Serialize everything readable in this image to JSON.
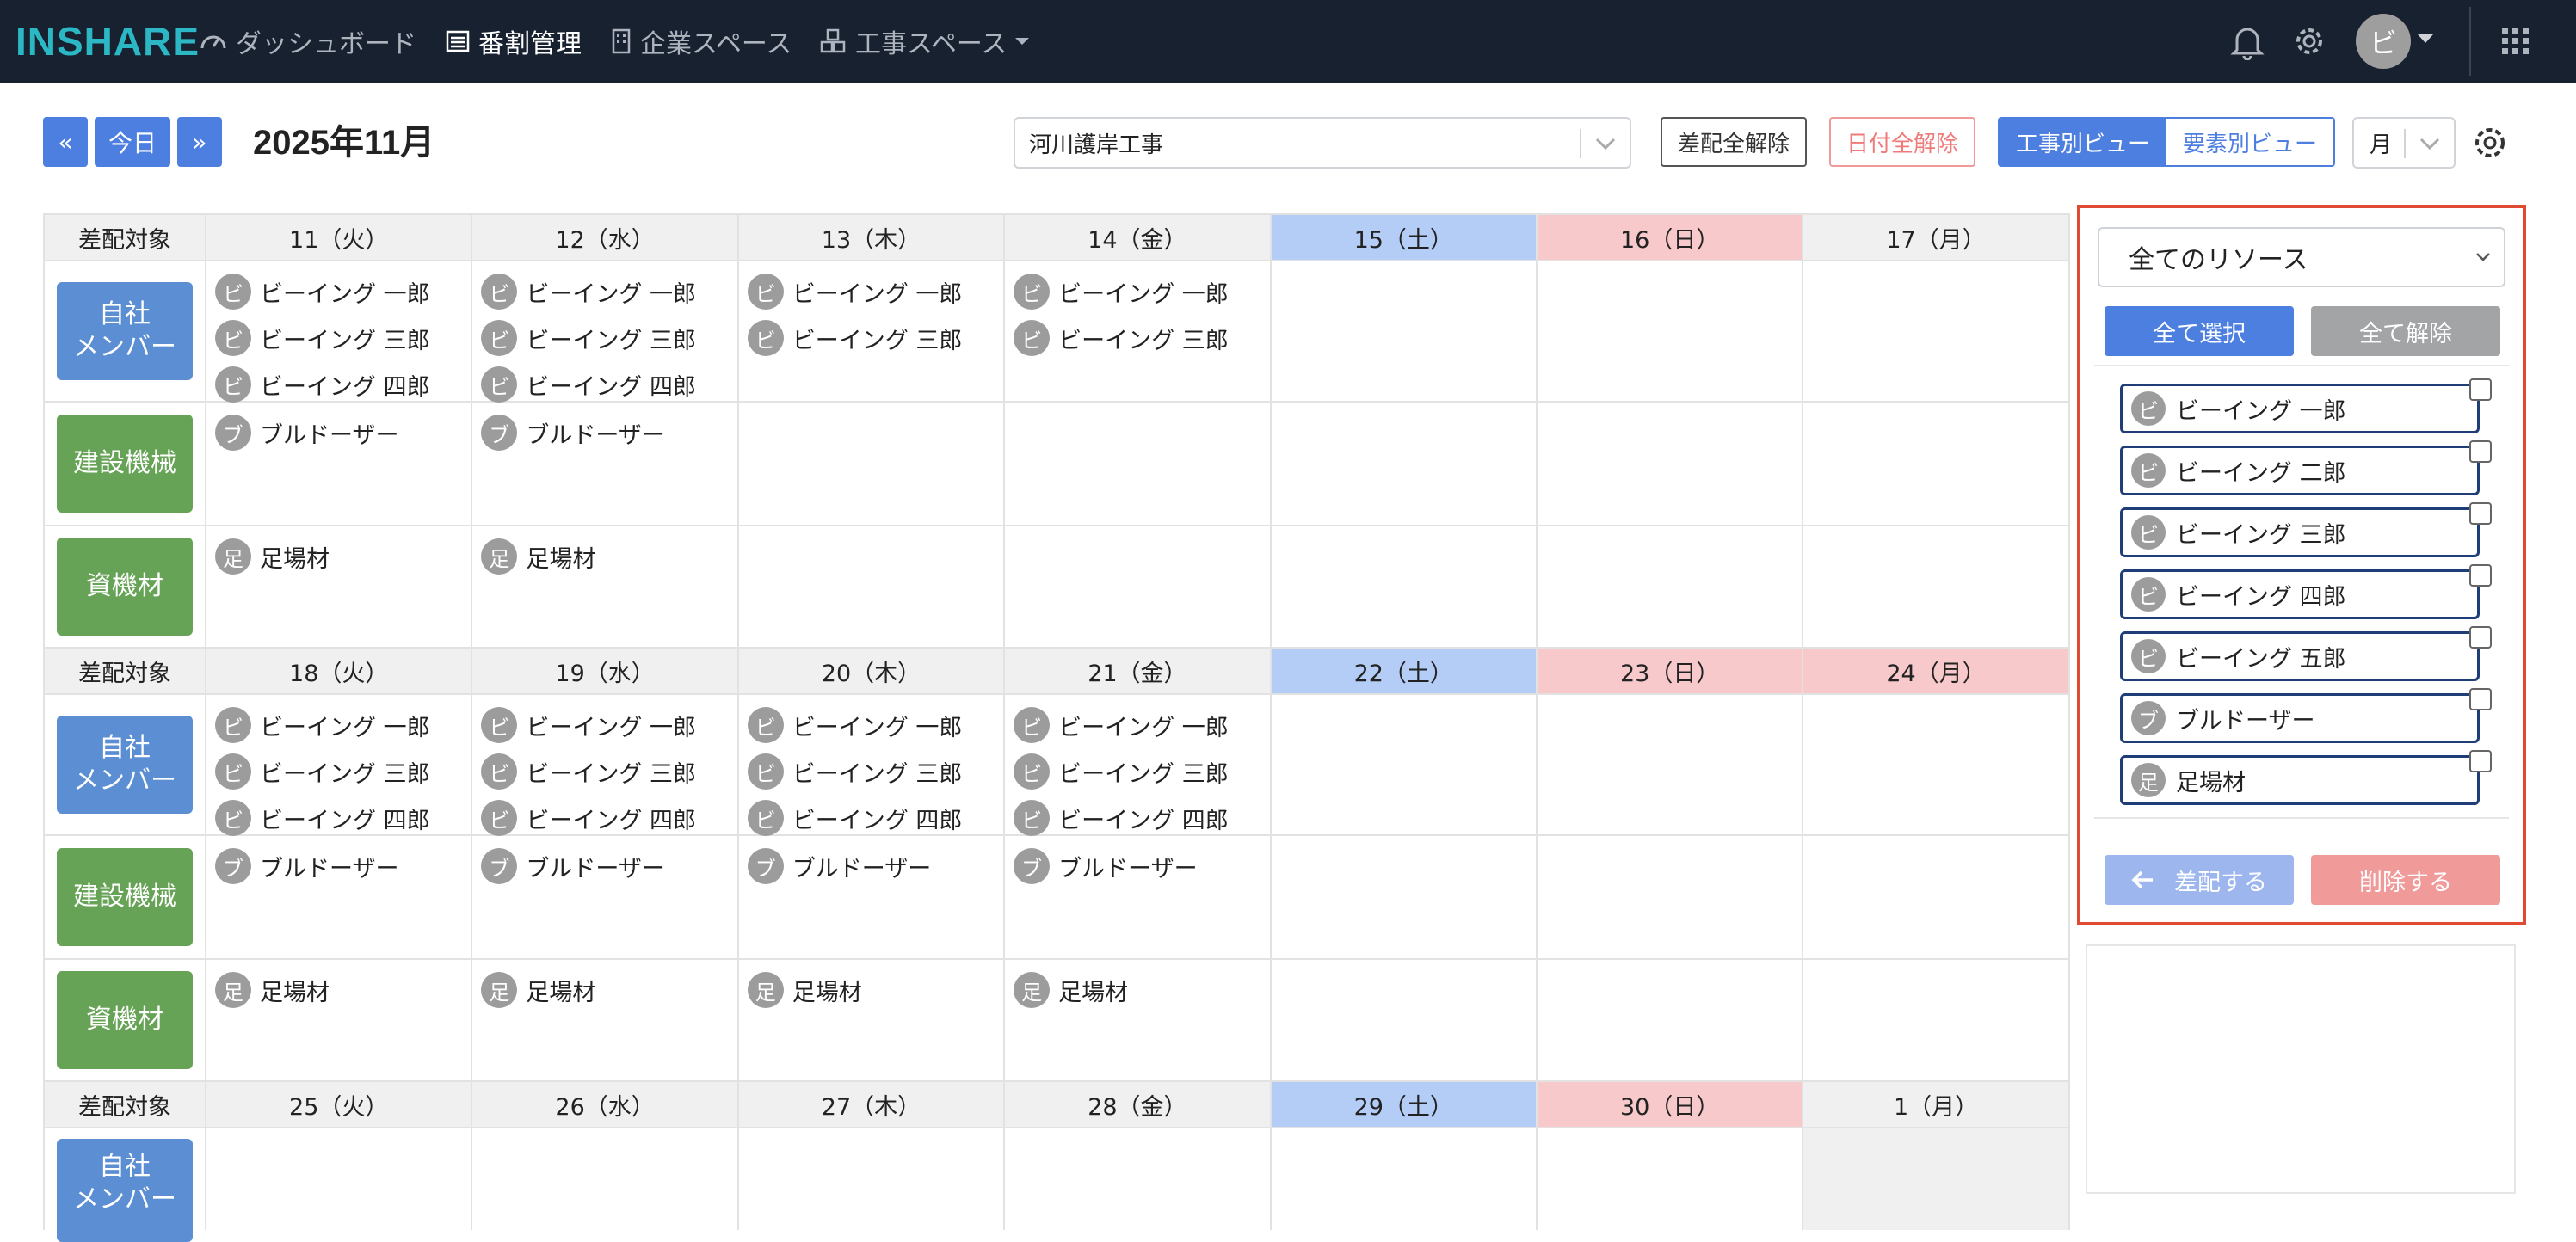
{
  "nav": {
    "logo": "INSHARE",
    "items": [
      "ダッシュボード",
      "番割管理",
      "企業スペース",
      "工事スペース"
    ],
    "user_initial": "ビ"
  },
  "toolbar": {
    "prev": "«",
    "today": "今日",
    "next": "»",
    "month": "2025年11月",
    "project": "河川護岸工事",
    "clear_all_assign": "差配全解除",
    "clear_all_dates": "日付全解除",
    "view_by_project": "工事別ビュー",
    "view_by_element": "要素別ビュー",
    "period": "月"
  },
  "calendar": {
    "target_label": "差配対象",
    "row_labels": {
      "members": "自社\nメンバー",
      "machines": "建設機械",
      "materials": "資機材"
    },
    "weeks": [
      {
        "days": [
          {
            "label": "11（火）",
            "type": "normal"
          },
          {
            "label": "12（水）",
            "type": "normal"
          },
          {
            "label": "13（木）",
            "type": "normal"
          },
          {
            "label": "14（金）",
            "type": "normal"
          },
          {
            "label": "15（土）",
            "type": "sat"
          },
          {
            "label": "16（日）",
            "type": "sun"
          },
          {
            "label": "17（月）",
            "type": "normal"
          }
        ],
        "members": [
          [
            "ビーイング 一郎",
            "ビーイング 三郎",
            "ビーイング 四郎"
          ],
          [
            "ビーイング 一郎",
            "ビーイング 三郎",
            "ビーイング 四郎"
          ],
          [
            "ビーイング 一郎",
            "ビーイング 三郎"
          ],
          [
            "ビーイング 一郎",
            "ビーイング 三郎"
          ],
          [],
          [],
          []
        ],
        "machines": [
          [
            "ブルドーザー"
          ],
          [
            "ブルドーザー"
          ],
          [],
          [],
          [],
          [],
          []
        ],
        "materials": [
          [
            "足場材"
          ],
          [
            "足場材"
          ],
          [],
          [],
          [],
          [],
          []
        ]
      },
      {
        "days": [
          {
            "label": "18（火）",
            "type": "normal"
          },
          {
            "label": "19（水）",
            "type": "normal"
          },
          {
            "label": "20（木）",
            "type": "normal"
          },
          {
            "label": "21（金）",
            "type": "normal"
          },
          {
            "label": "22（土）",
            "type": "sat"
          },
          {
            "label": "23（日）",
            "type": "sun"
          },
          {
            "label": "24（月）",
            "type": "sun"
          }
        ],
        "members": [
          [
            "ビーイング 一郎",
            "ビーイング 三郎",
            "ビーイング 四郎"
          ],
          [
            "ビーイング 一郎",
            "ビーイング 三郎",
            "ビーイング 四郎"
          ],
          [
            "ビーイング 一郎",
            "ビーイング 三郎",
            "ビーイング 四郎"
          ],
          [
            "ビーイング 一郎",
            "ビーイング 三郎",
            "ビーイング 四郎"
          ],
          [],
          [],
          []
        ],
        "machines": [
          [
            "ブルドーザー"
          ],
          [
            "ブルドーザー"
          ],
          [
            "ブルドーザー"
          ],
          [
            "ブルドーザー"
          ],
          [],
          [],
          []
        ],
        "materials": [
          [
            "足場材"
          ],
          [
            "足場材"
          ],
          [
            "足場材"
          ],
          [
            "足場材"
          ],
          [],
          [],
          []
        ]
      },
      {
        "days": [
          {
            "label": "25（火）",
            "type": "normal"
          },
          {
            "label": "26（水）",
            "type": "normal"
          },
          {
            "label": "27（木）",
            "type": "normal"
          },
          {
            "label": "28（金）",
            "type": "normal"
          },
          {
            "label": "29（土）",
            "type": "sat"
          },
          {
            "label": "30（日）",
            "type": "sun"
          },
          {
            "label": "1（月）",
            "type": "normal"
          }
        ]
      }
    ]
  },
  "panel": {
    "resource_select": "全てのリソース",
    "select_all": "全て選択",
    "deselect_all": "全て解除",
    "resources": [
      {
        "initial": "ビ",
        "name": "ビーイング 一郎"
      },
      {
        "initial": "ビ",
        "name": "ビーイング 二郎"
      },
      {
        "initial": "ビ",
        "name": "ビーイング 三郎"
      },
      {
        "initial": "ビ",
        "name": "ビーイング 四郎"
      },
      {
        "initial": "ビ",
        "name": "ビーイング 五郎"
      },
      {
        "initial": "ブ",
        "name": "ブルドーザー"
      },
      {
        "initial": "足",
        "name": "足場材"
      }
    ],
    "assign": "差配する",
    "delete": "削除する"
  },
  "colors": {
    "navbar": "#182130",
    "primary": "#4d7fe0",
    "members": "#5b8ed2",
    "machines_materials": "#67a356",
    "saturday": "#b4cdf6",
    "sunday": "#f7c9cb",
    "highlight": "#e04a32"
  }
}
